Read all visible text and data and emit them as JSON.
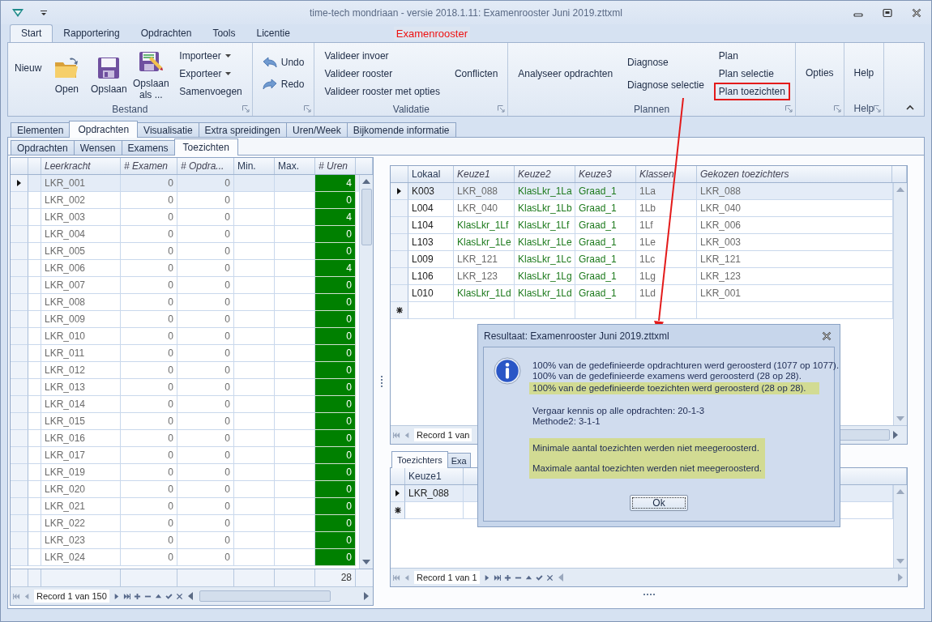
{
  "window": {
    "title": "time-tech mondriaan - versie 2018.1.11: Examenrooster Juni 2019.zttxml"
  },
  "ribbon": {
    "tabs": [
      {
        "label": "Start",
        "selected": true
      },
      {
        "label": "Rapportering",
        "selected": false
      },
      {
        "label": "Opdrachten",
        "selected": false
      },
      {
        "label": "Tools",
        "selected": false
      },
      {
        "label": "Licentie",
        "selected": false
      }
    ],
    "context_label": "Examenrooster",
    "groups": [
      {
        "label": "Bestand",
        "columns": [
          [
            {
              "kind": "plain",
              "label": "Nieuw"
            }
          ],
          [
            {
              "kind": "large",
              "label": "Open"
            }
          ],
          [
            {
              "kind": "large",
              "label": "Opslaan"
            }
          ],
          [
            {
              "kind": "large",
              "label": "Opslaan als ..."
            }
          ],
          [
            {
              "kind": "small",
              "label": "Importeer",
              "dropdown": true
            },
            {
              "kind": "small",
              "label": "Exporteer",
              "dropdown": true
            },
            {
              "kind": "small",
              "label": "Samenvoegen",
              "dropdown": false
            }
          ]
        ]
      },
      {
        "columns": [
          [
            {
              "kind": "small",
              "label": "Undo"
            },
            {
              "kind": "small",
              "label": "Redo"
            }
          ]
        ]
      },
      {
        "label": "Validatie",
        "columns": [
          [
            {
              "kind": "small",
              "label": "Valideer invoer"
            },
            {
              "kind": "small",
              "label": "Valideer rooster"
            },
            {
              "kind": "small",
              "label": "Valideer rooster met opties"
            }
          ],
          [
            {
              "kind": "small",
              "label": "Conflicten"
            }
          ]
        ]
      },
      {
        "label": "Plannen",
        "columns": [
          [
            {
              "kind": "small",
              "label": "Analyseer opdrachten"
            }
          ],
          [
            {
              "kind": "small",
              "label": "Diagnose"
            },
            {
              "kind": "small",
              "label": "Diagnose selectie"
            }
          ],
          [
            {
              "kind": "small",
              "label": "Plan",
              "highlighted": false
            },
            {
              "kind": "small",
              "label": "Plan selectie",
              "highlighted": false
            },
            {
              "kind": "small",
              "label": "Plan toezichten",
              "highlighted": true
            }
          ]
        ]
      },
      {
        "columns": [
          [
            {
              "kind": "small",
              "label": "Opties"
            }
          ]
        ]
      },
      {
        "label": "Help",
        "columns": [
          [
            {
              "kind": "small",
              "label": "Help"
            }
          ]
        ]
      }
    ]
  },
  "tabs": [
    {
      "label": "Elementen",
      "selected": false
    },
    {
      "label": "Opdrachten",
      "selected": true
    },
    {
      "label": "Visualisatie",
      "selected": false
    },
    {
      "label": "Extra spreidingen",
      "selected": false
    },
    {
      "label": "Uren/Week",
      "selected": false
    },
    {
      "label": "Bijkomende informatie",
      "selected": false
    }
  ],
  "subtabs": [
    {
      "label": "Opdrachten",
      "selected": false
    },
    {
      "label": "Wensen",
      "selected": false
    },
    {
      "label": "Examens",
      "selected": false
    },
    {
      "label": "Toezichten",
      "selected": true
    }
  ],
  "teacher_grid": {
    "columns": [
      {
        "label": "Leerkracht",
        "italic": true
      },
      {
        "label": "# Examen",
        "italic": true
      },
      {
        "label": "# Opdra...",
        "italic": true
      },
      {
        "label": "Min.",
        "italic": false
      },
      {
        "label": "Max.",
        "italic": false
      },
      {
        "label": "# Uren",
        "italic": true
      }
    ],
    "rows": [
      {
        "selected": true,
        "teacher": "LKR_001",
        "exams": "0",
        "assignments": "0",
        "hours": "4"
      },
      {
        "selected": false,
        "teacher": "LKR_002",
        "exams": "0",
        "assignments": "0",
        "hours": "0"
      },
      {
        "selected": false,
        "teacher": "LKR_003",
        "exams": "0",
        "assignments": "0",
        "hours": "4"
      },
      {
        "selected": false,
        "teacher": "LKR_004",
        "exams": "0",
        "assignments": "0",
        "hours": "0"
      },
      {
        "selected": false,
        "teacher": "LKR_005",
        "exams": "0",
        "assignments": "0",
        "hours": "0"
      },
      {
        "selected": false,
        "teacher": "LKR_006",
        "exams": "0",
        "assignments": "0",
        "hours": "4"
      },
      {
        "selected": false,
        "teacher": "LKR_007",
        "exams": "0",
        "assignments": "0",
        "hours": "0"
      },
      {
        "selected": false,
        "teacher": "LKR_008",
        "exams": "0",
        "assignments": "0",
        "hours": "0"
      },
      {
        "selected": false,
        "teacher": "LKR_009",
        "exams": "0",
        "assignments": "0",
        "hours": "0"
      },
      {
        "selected": false,
        "teacher": "LKR_010",
        "exams": "0",
        "assignments": "0",
        "hours": "0"
      },
      {
        "selected": false,
        "teacher": "LKR_011",
        "exams": "0",
        "assignments": "0",
        "hours": "0"
      },
      {
        "selected": false,
        "teacher": "LKR_012",
        "exams": "0",
        "assignments": "0",
        "hours": "0"
      },
      {
        "selected": false,
        "teacher": "LKR_013",
        "exams": "0",
        "assignments": "0",
        "hours": "0"
      },
      {
        "selected": false,
        "teacher": "LKR_014",
        "exams": "0",
        "assignments": "0",
        "hours": "0"
      },
      {
        "selected": false,
        "teacher": "LKR_015",
        "exams": "0",
        "assignments": "0",
        "hours": "0"
      },
      {
        "selected": false,
        "teacher": "LKR_016",
        "exams": "0",
        "assignments": "0",
        "hours": "0"
      },
      {
        "selected": false,
        "teacher": "LKR_017",
        "exams": "0",
        "assignments": "0",
        "hours": "0"
      },
      {
        "selected": false,
        "teacher": "LKR_019",
        "exams": "0",
        "assignments": "0",
        "hours": "0"
      },
      {
        "selected": false,
        "teacher": "LKR_020",
        "exams": "0",
        "assignments": "0",
        "hours": "0"
      },
      {
        "selected": false,
        "teacher": "LKR_021",
        "exams": "0",
        "assignments": "0",
        "hours": "0"
      },
      {
        "selected": false,
        "teacher": "LKR_022",
        "exams": "0",
        "assignments": "0",
        "hours": "0"
      },
      {
        "selected": false,
        "teacher": "LKR_023",
        "exams": "0",
        "assignments": "0",
        "hours": "0"
      },
      {
        "selected": false,
        "teacher": "LKR_024",
        "exams": "0",
        "assignments": "0",
        "hours": "0"
      }
    ],
    "total_hours": "28",
    "navigator": "Record 1 van 150"
  },
  "room_grid": {
    "columns": [
      {
        "label": "Lokaal",
        "italic": false
      },
      {
        "label": "Keuze1",
        "italic": true
      },
      {
        "label": "Keuze2",
        "italic": true
      },
      {
        "label": "Keuze3",
        "italic": true
      },
      {
        "label": "Klassen",
        "italic": true
      },
      {
        "label": "Gekozen toezichters",
        "italic": true
      }
    ],
    "rows": [
      {
        "selected": true,
        "room": "K003",
        "choice1": "LKR_088",
        "choice1_class": false,
        "choice2": "KlasLkr_1La",
        "choice3": "Graad_1",
        "classes": "1La",
        "supervisors": "LKR_088"
      },
      {
        "selected": false,
        "room": "L004",
        "choice1": "LKR_040",
        "choice1_class": false,
        "choice2": "KlasLkr_1Lb",
        "choice3": "Graad_1",
        "classes": "1Lb",
        "supervisors": "LKR_040"
      },
      {
        "selected": false,
        "room": "L104",
        "choice1": "KlasLkr_1Lf",
        "choice1_class": true,
        "choice2": "KlasLkr_1Lf",
        "choice3": "Graad_1",
        "classes": "1Lf",
        "supervisors": "LKR_006"
      },
      {
        "selected": false,
        "room": "L103",
        "choice1": "KlasLkr_1Le",
        "choice1_class": true,
        "choice2": "KlasLkr_1Le",
        "choice3": "Graad_1",
        "classes": "1Le",
        "supervisors": "LKR_003"
      },
      {
        "selected": false,
        "room": "L009",
        "choice1": "LKR_121",
        "choice1_class": false,
        "choice2": "KlasLkr_1Lc",
        "choice3": "Graad_1",
        "classes": "1Lc",
        "supervisors": "LKR_121"
      },
      {
        "selected": false,
        "room": "L106",
        "choice1": "LKR_123",
        "choice1_class": false,
        "choice2": "KlasLkr_1Lg",
        "choice3": "Graad_1",
        "classes": "1Lg",
        "supervisors": "LKR_123"
      },
      {
        "selected": false,
        "room": "L010",
        "choice1": "KlasLkr_1Ld",
        "choice1_class": true,
        "choice2": "KlasLkr_1Ld",
        "choice3": "Graad_1",
        "classes": "1Ld",
        "supervisors": "LKR_001"
      }
    ],
    "navigator": "Record 1 van"
  },
  "supervisor_panel": {
    "tabs": [
      {
        "label": "Toezichters",
        "selected": true
      },
      {
        "label": "Exa",
        "selected": false
      }
    ],
    "column": "Keuze1",
    "rows": [
      {
        "selected": true,
        "choice1": "LKR_088"
      }
    ],
    "navigator": "Record 1 van 1"
  },
  "dialog": {
    "title": "Resultaat: Examenrooster Juni 2019.zttxml",
    "blocks": [
      {
        "highlighted": false,
        "lines": [
          "100% van de gedefinieerde opdrachturen werd geroosterd (1077 op 1077).",
          "100% van de gedefinieerde examens werd geroosterd (28 op 28)."
        ]
      },
      {
        "highlighted": true,
        "lines": [
          "100% van de gedefinieerde toezichten werd geroosterd (28 op 28)."
        ]
      },
      {
        "highlighted": false,
        "lines": [
          "Vergaar kennis op alle opdrachten: 20-1-3",
          "Methode2: 3-1-1"
        ]
      },
      {
        "highlighted": true,
        "lines": [
          "Minimale aantal toezichten werden niet meegeroosterd.",
          "Maximale aantal toezichten werden niet meegeroosterd."
        ]
      }
    ],
    "button": "Ok"
  }
}
